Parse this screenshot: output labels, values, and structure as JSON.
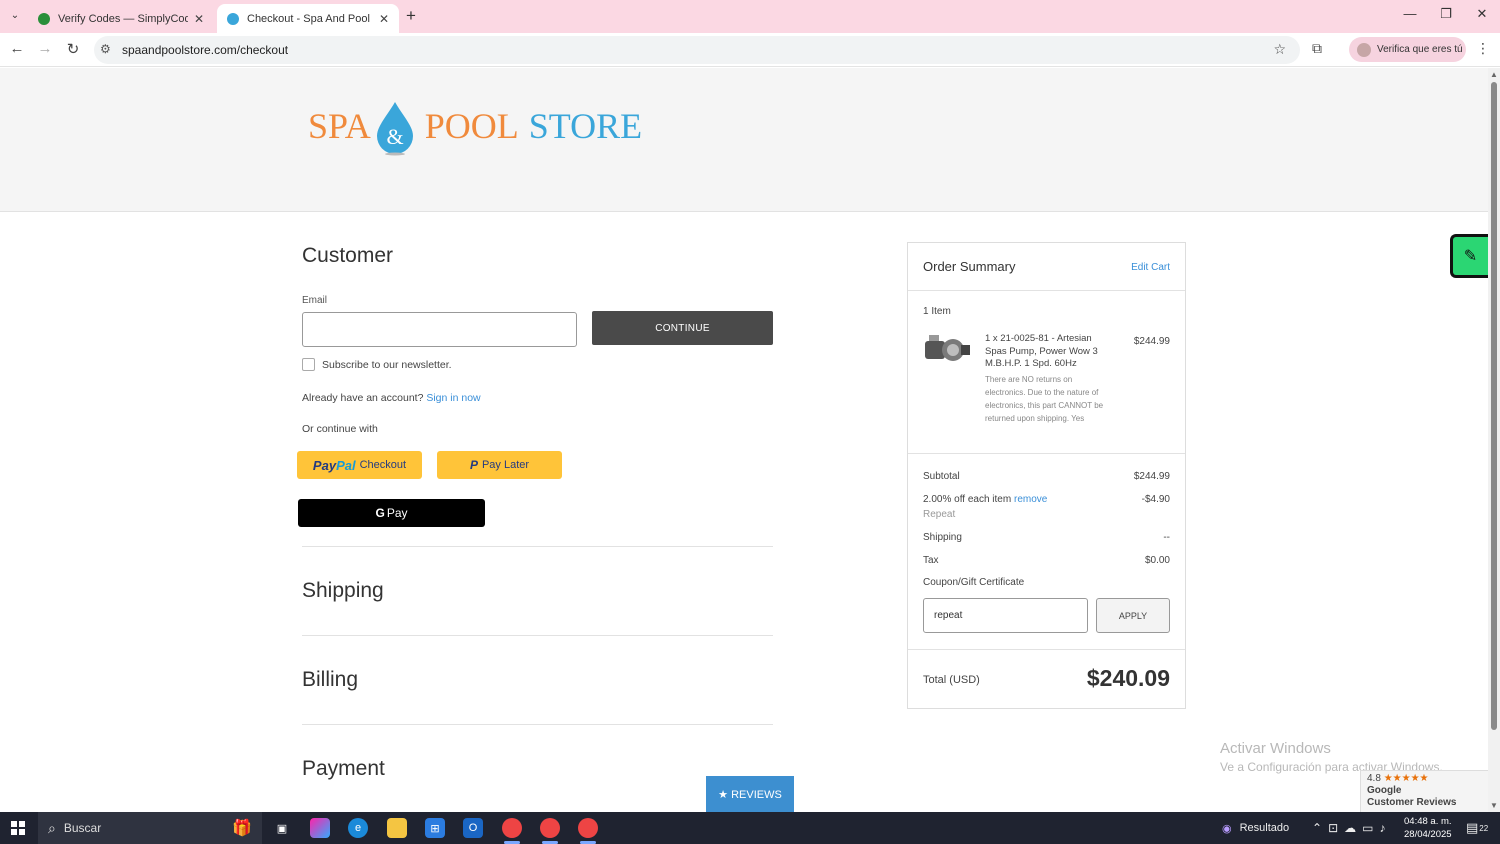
{
  "browser": {
    "tabs": [
      {
        "title": "Verify Codes — SimplyCodes",
        "active": false
      },
      {
        "title": "Checkout - Spa And Pool Store",
        "active": true
      }
    ],
    "url": "spaandpoolstore.com/checkout",
    "profile_label": "Verifica que eres tú"
  },
  "logo": {
    "spa": "SPA",
    "amp": "&",
    "pool": "POOL",
    "store": "STORE"
  },
  "customer": {
    "heading": "Customer",
    "email_label": "Email",
    "email_value": "",
    "continue_label": "CONTINUE",
    "newsletter_label": "Subscribe to our newsletter.",
    "account_prompt": "Already have an account?",
    "sign_in_link": "Sign in now",
    "or_continue": "Or continue with",
    "paypal_label": "Checkout",
    "paypal_brand_1": "Pay",
    "paypal_brand_2": "Pal",
    "paylater_label": "Pay Later",
    "gpay_g": "G",
    "gpay_label": "Pay"
  },
  "sections": {
    "shipping": "Shipping",
    "billing": "Billing",
    "payment": "Payment"
  },
  "summary": {
    "title": "Order Summary",
    "edit_cart": "Edit Cart",
    "item_count": "1 Item",
    "item_name": "1 x 21-0025-81 - Artesian Spas Pump, Power Wow 3 M.B.H.P. 1 Spd. 60Hz",
    "item_note": "There are NO returns on electronics. Due to the nature of electronics, this part CANNOT be returned upon shipping. Yes",
    "item_price": "$244.99",
    "subtotal_label": "Subtotal",
    "subtotal_value": "$244.99",
    "discount_label": "2.00% off each item",
    "discount_remove": "remove",
    "discount_code": "Repeat",
    "discount_value": "-$4.90",
    "shipping_label": "Shipping",
    "shipping_value": "--",
    "tax_label": "Tax",
    "tax_value": "$0.00",
    "coupon_link": "Coupon/Gift Certificate",
    "coupon_value": "repeat",
    "apply_label": "APPLY",
    "total_label": "Total (USD)",
    "total_value": "$240.09"
  },
  "overlay": {
    "activate_title": "Activar Windows",
    "activate_sub": "Ve a Configuración para activar Windows.",
    "reviews_label": "★ REVIEWS",
    "google_rating": "4.8",
    "google_stars": "★★★★★",
    "google_name": "Google",
    "google_reviews": "Customer Reviews"
  },
  "taskbar": {
    "search_placeholder": "Buscar",
    "tray_label": "Resultado",
    "time": "04:48 a. m.",
    "date": "28/04/2025",
    "notification_count": "22"
  },
  "colors": {
    "tab_bar": "#fbd8e3",
    "accent_link": "#3a8fd8",
    "logo_orange": "#f08a3c",
    "logo_blue": "#3aa6da",
    "paypal_yellow": "#ffc439",
    "continue_button": "#4a4a4a",
    "reviews_button": "#3d8fd0"
  }
}
